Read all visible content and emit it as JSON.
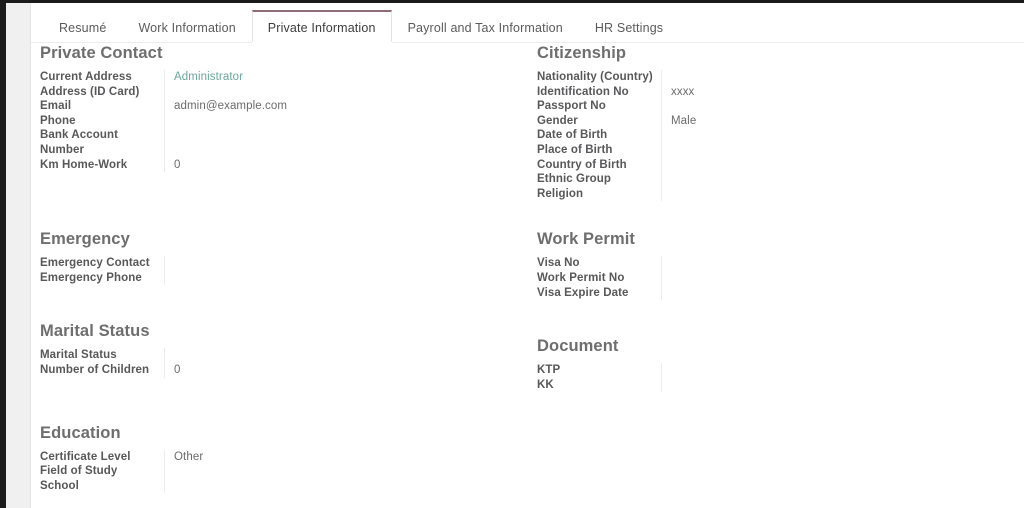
{
  "tabs": [
    {
      "label": "Resumé",
      "active": false
    },
    {
      "label": "Work Information",
      "active": false
    },
    {
      "label": "Private Information",
      "active": true
    },
    {
      "label": "Payroll and Tax Information",
      "active": false
    },
    {
      "label": "HR Settings",
      "active": false
    }
  ],
  "left_column": [
    {
      "title": "Private Contact",
      "fields": [
        {
          "label": "Current Address",
          "value": "Administrator",
          "is_link": true
        },
        {
          "label": "Address (ID Card)",
          "value": ""
        },
        {
          "label": "Email",
          "value": "admin@example.com"
        },
        {
          "label": "Phone",
          "value": ""
        },
        {
          "label": "Bank Account Number",
          "value": ""
        },
        {
          "label": "Km Home-Work",
          "value": "0"
        }
      ]
    },
    {
      "title": "Emergency",
      "fields": [
        {
          "label": "Emergency Contact",
          "value": ""
        },
        {
          "label": "Emergency Phone",
          "value": ""
        }
      ]
    },
    {
      "title": "Marital Status",
      "fields": [
        {
          "label": "Marital Status",
          "value": ""
        },
        {
          "label": "Number of Children",
          "value": "0"
        }
      ]
    },
    {
      "title": "Education",
      "fields": [
        {
          "label": "Certificate Level",
          "value": "Other"
        },
        {
          "label": "Field of Study",
          "value": ""
        },
        {
          "label": "School",
          "value": ""
        }
      ]
    }
  ],
  "right_column": [
    {
      "title": "Citizenship",
      "fields": [
        {
          "label": "Nationality (Country)",
          "value": ""
        },
        {
          "label": "Identification No",
          "value": "xxxx"
        },
        {
          "label": "Passport No",
          "value": ""
        },
        {
          "label": "Gender",
          "value": "Male"
        },
        {
          "label": "Date of Birth",
          "value": ""
        },
        {
          "label": "Place of Birth",
          "value": ""
        },
        {
          "label": "Country of Birth",
          "value": ""
        },
        {
          "label": "Ethnic Group",
          "value": ""
        },
        {
          "label": "Religion",
          "value": ""
        }
      ]
    },
    {
      "title": "Work Permit",
      "fields": [
        {
          "label": "Visa No",
          "value": ""
        },
        {
          "label": "Work Permit No",
          "value": ""
        },
        {
          "label": "Visa Expire Date",
          "value": ""
        }
      ]
    },
    {
      "title": "Document",
      "fields": [
        {
          "label": "KTP",
          "value": ""
        },
        {
          "label": "KK",
          "value": ""
        }
      ]
    }
  ],
  "colors": {
    "active_tab_accent": "#8f6b77",
    "link": "#6aa79c",
    "heading": "#6e6e6e",
    "label": "#58585a",
    "value": "#6b6b6b",
    "divider": "#ececec",
    "window_edge": "#1b1b1b",
    "gutter": "#f0f0f0"
  }
}
